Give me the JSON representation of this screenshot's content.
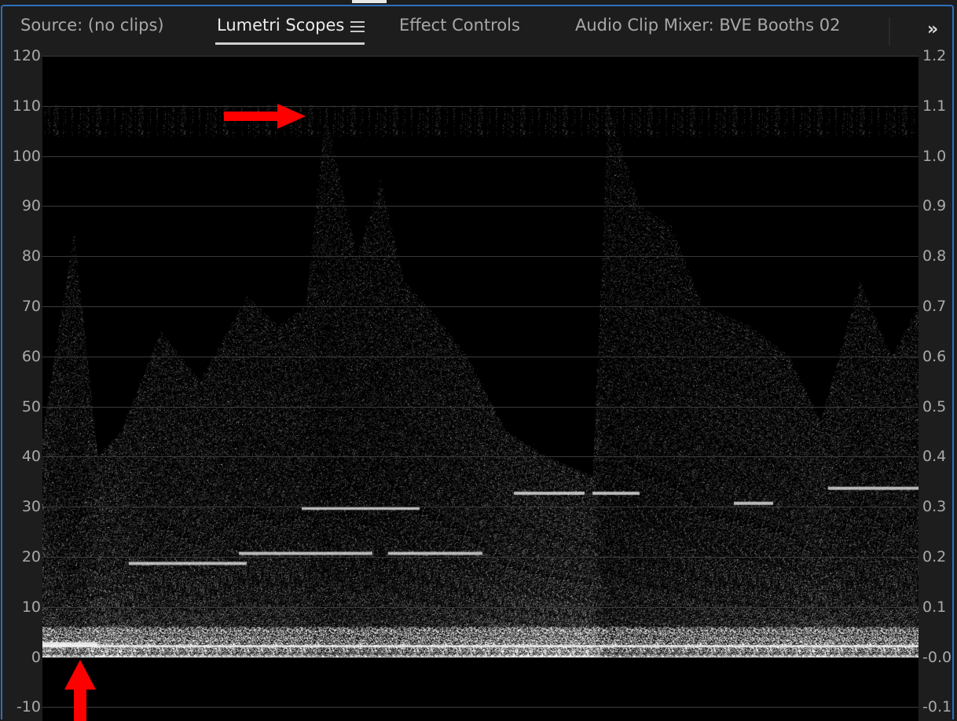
{
  "tabs": [
    {
      "label": "Source: (no clips)",
      "active": false
    },
    {
      "label": "Lumetri Scopes",
      "active": true
    },
    {
      "label": "Effect Controls",
      "active": false
    },
    {
      "label": "Audio Clip Mixer: BVE Booths 02",
      "active": false
    }
  ],
  "icons": {
    "panel_menu": "hamburger-menu-icon",
    "overflow": "double-chevron-right-icon",
    "annotation": "red-arrow-icon"
  },
  "overflow_label": "»",
  "scope": {
    "left_axis": [
      "120",
      "110",
      "100",
      "90",
      "80",
      "70",
      "60",
      "50",
      "40",
      "30",
      "20",
      "10",
      "0",
      "-10"
    ],
    "right_axis": [
      "1.2",
      "1.1",
      "1.0",
      "0.9",
      "0.8",
      "0.7",
      "0.6",
      "0.5",
      "0.4",
      "0.3",
      "0.2",
      "0.1",
      "-0.0",
      "-0.1"
    ],
    "range": [
      -10,
      120
    ],
    "grid": true
  },
  "colors": {
    "panel_bg": "#1d1d1d",
    "scope_bg": "#050505",
    "focus_border": "#2f6fbf",
    "annotation_arrow": "#ff0000",
    "trace": "#ffffff"
  }
}
